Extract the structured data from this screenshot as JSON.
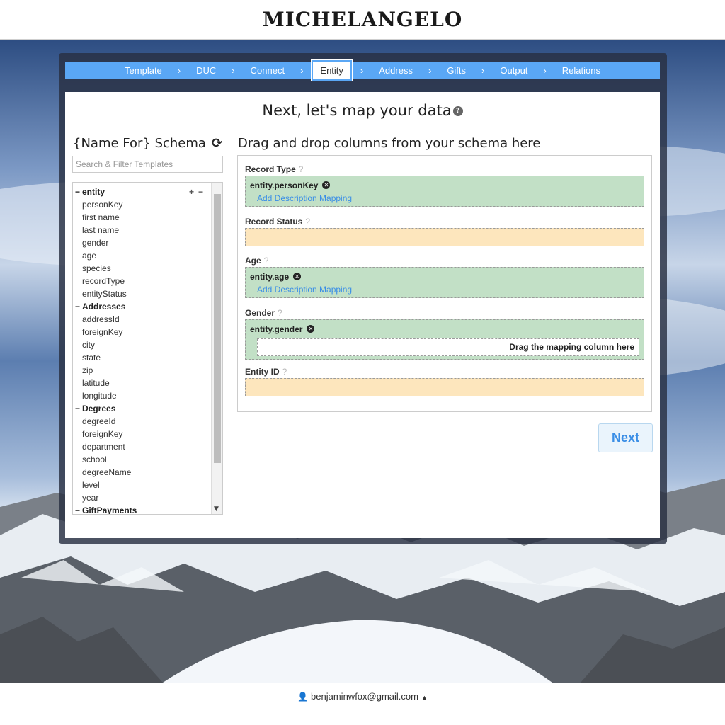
{
  "brand": "MICHELANGELO",
  "steps": [
    "Template",
    "DUC",
    "Connect",
    "Entity",
    "Address",
    "Gifts",
    "Output",
    "Relations"
  ],
  "active_step": "Entity",
  "page_title": "Next, let's map your data",
  "schema": {
    "title": "{Name For} Schema",
    "search_placeholder": "Search & Filter Templates",
    "groups": [
      {
        "name": "entity",
        "items": [
          "personKey",
          "first name",
          "last name",
          "gender",
          "age",
          "species",
          "recordType",
          "entityStatus"
        ]
      },
      {
        "name": "Addresses",
        "items": [
          "addressId",
          "foreignKey",
          "city",
          "state",
          "zip",
          "latitude",
          "longitude"
        ]
      },
      {
        "name": "Degrees",
        "items": [
          "degreeId",
          "foreignKey",
          "department",
          "school",
          "degreeName",
          "level",
          "year"
        ]
      },
      {
        "name": "GiftPayments",
        "items": []
      }
    ]
  },
  "mapping": {
    "title": "Drag and drop columns from your schema here",
    "fields": [
      {
        "label": "Record Type",
        "value": "entity.personKey",
        "action": "Add Description Mapping"
      },
      {
        "label": "Record Status",
        "value": ""
      },
      {
        "label": "Age",
        "value": "entity.age",
        "action": "Add Description Mapping"
      },
      {
        "label": "Gender",
        "value": "entity.gender",
        "subdrop": "Drag the mapping column here"
      },
      {
        "label": "Entity ID",
        "value": ""
      }
    ]
  },
  "next_label": "Next",
  "user_email": "benjaminwfox@gmail.com",
  "colors": {
    "stepper": "#5aa7f5",
    "mapped": "#c2e0c6",
    "unmapped": "#fde6bd",
    "link": "#3a8ee6"
  }
}
